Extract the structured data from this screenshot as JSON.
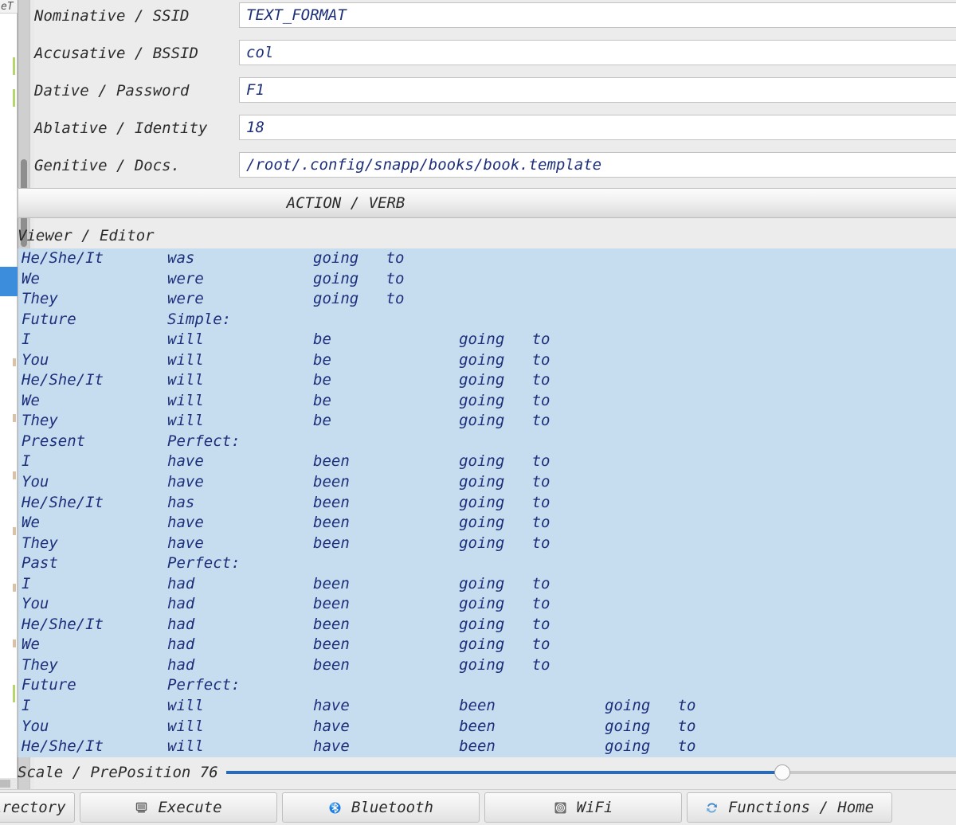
{
  "background_window": {
    "title_fragment": "eT",
    "name": "background-editor-window"
  },
  "form": {
    "rows": [
      {
        "label": "Nominative / SSID",
        "value": "TEXT_FORMAT",
        "name": "ssid"
      },
      {
        "label": "Accusative / BSSID",
        "value": "col",
        "name": "bssid"
      },
      {
        "label": "Dative / Password",
        "value": "F1",
        "name": "password"
      },
      {
        "label": "Ablative / Identity",
        "value": "18",
        "name": "identity"
      },
      {
        "label": "Genitive / Docs.",
        "value": "/root/.config/snapp/books/book.template",
        "name": "docs"
      }
    ]
  },
  "action_button": {
    "label": "ACTION / VERB"
  },
  "viewer": {
    "label": "Viewer / Editor",
    "lines": [
      "He/She/It\twas\t\tgoing\tto",
      "We\t\twere\t\tgoing\tto",
      "They\t\twere\t\tgoing\tto",
      "Future\t\tSimple:",
      "I\t\twill\t\tbe\t\tgoing\tto",
      "You\t\twill\t\tbe\t\tgoing\tto",
      "He/She/It\twill\t\tbe\t\tgoing\tto",
      "We\t\twill\t\tbe\t\tgoing\tto",
      "They\t\twill\t\tbe\t\tgoing\tto",
      "Present\t\tPerfect:",
      "I\t\thave\t\tbeen\t\tgoing\tto",
      "You\t\thave\t\tbeen\t\tgoing\tto",
      "He/She/It\thas\t\tbeen\t\tgoing\tto",
      "We\t\thave\t\tbeen\t\tgoing\tto",
      "They\t\thave\t\tbeen\t\tgoing\tto",
      "Past\t\tPerfect:",
      "I\t\thad\t\tbeen\t\tgoing\tto",
      "You\t\thad\t\tbeen\t\tgoing\tto",
      "He/She/It\thad\t\tbeen\t\tgoing\tto",
      "We\t\thad\t\tbeen\t\tgoing\tto",
      "They\t\thad\t\tbeen\t\tgoing\tto",
      "Future\t\tPerfect:",
      "I\t\twill\t\thave\t\tbeen\t\tgoing\tto",
      "You\t\twill\t\thave\t\tbeen\t\tgoing\tto",
      "He/She/It\twill\t\thave\t\tbeen\t\tgoing\tto"
    ],
    "selection_color": "#c6dcef",
    "text_color": "#1d2f7a"
  },
  "slider": {
    "label": "Scale / PrePosition",
    "value": "76",
    "percent": 76,
    "fill_color": "#2a6bb5"
  },
  "toolbar": {
    "buttons": [
      {
        "label": "irectory",
        "icon": "none",
        "name": "directory-button"
      },
      {
        "label": "Execute",
        "icon": "monitor-icon",
        "name": "execute-button"
      },
      {
        "label": "Bluetooth",
        "icon": "bluetooth-icon",
        "name": "bluetooth-button"
      },
      {
        "label": "WiFi",
        "icon": "wifi-icon",
        "name": "wifi-button"
      },
      {
        "label": "Functions / Home",
        "icon": "refresh-icon",
        "name": "functions-home-button"
      }
    ]
  }
}
